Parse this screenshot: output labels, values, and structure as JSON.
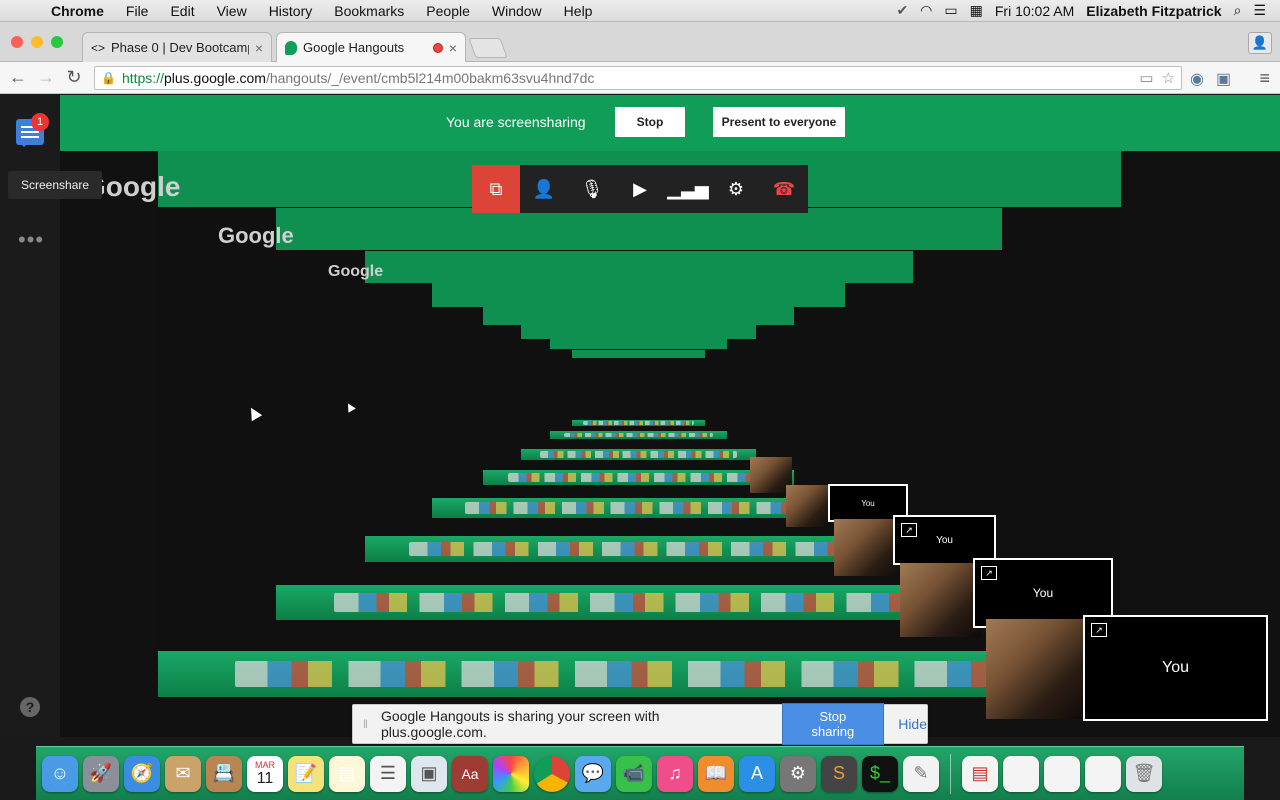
{
  "menubar": {
    "app": "Chrome",
    "items": [
      "File",
      "Edit",
      "View",
      "History",
      "Bookmarks",
      "People",
      "Window",
      "Help"
    ],
    "clock": "Fri 10:02 AM",
    "user": "Elizabeth Fitzpatrick"
  },
  "tabs": [
    {
      "label": "Phase 0 | Dev Bootcamp",
      "close": "×"
    },
    {
      "label": "Google Hangouts",
      "close": "×"
    }
  ],
  "toolbar": {
    "url_scheme": "https://",
    "url_host": "plus.google.com",
    "url_path": "/hangouts/_/event/cmb5l214m00bakm63svu4hnd7dc"
  },
  "hangouts": {
    "badge_count": "1",
    "tooltip": "Screenshare",
    "sharing_text": "You are screensharing",
    "stop_label": "Stop",
    "present_label": "Present to everyone",
    "you_label": "You",
    "logo_text": "Google"
  },
  "notice": {
    "text": "Google Hangouts is sharing your screen with plus.google.com.",
    "stop_sharing": "Stop sharing",
    "hide": "Hide"
  },
  "dock": {
    "calendar_month": "MAR",
    "calendar_day": "11",
    "dictionary": "Aa"
  },
  "colors": {
    "hangouts_green": "#0f9d58",
    "accent_red": "#db4437",
    "stop_sharing_blue": "#4a8ee6"
  }
}
